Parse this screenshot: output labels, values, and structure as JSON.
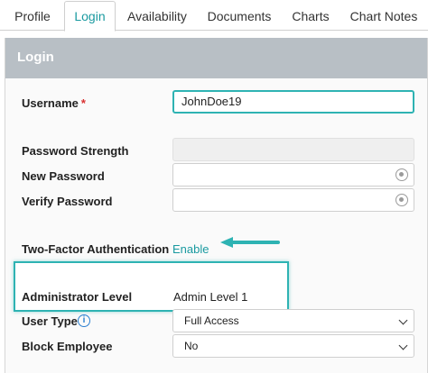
{
  "tabs": [
    {
      "label": "Profile"
    },
    {
      "label": "Login",
      "active": true
    },
    {
      "label": "Availability"
    },
    {
      "label": "Documents"
    },
    {
      "label": "Charts"
    },
    {
      "label": "Chart Notes"
    }
  ],
  "panel": {
    "title": "Login",
    "username": {
      "label": "Username",
      "required_marker": "*",
      "value": "JohnDoe19"
    },
    "password_strength": {
      "label": "Password Strength"
    },
    "new_password": {
      "label": "New Password",
      "icon": "eye-icon"
    },
    "verify_password": {
      "label": "Verify Password",
      "icon": "eye-icon"
    },
    "two_factor": {
      "label": "Two-Factor Authentication",
      "link": "Enable",
      "highlight_color": "#2eb3b3"
    },
    "admin_level": {
      "label": "Administrator Level",
      "value": "Admin Level 1"
    },
    "user_type": {
      "label": "User Type",
      "info_icon": "i",
      "value": "Full Access"
    },
    "block_employee": {
      "label": "Block Employee",
      "value": "No"
    }
  },
  "colors": {
    "accent": "#1a9aa0",
    "header_bg": "#b8bfc5",
    "required": "#d93030",
    "info": "#2a7fd0"
  }
}
